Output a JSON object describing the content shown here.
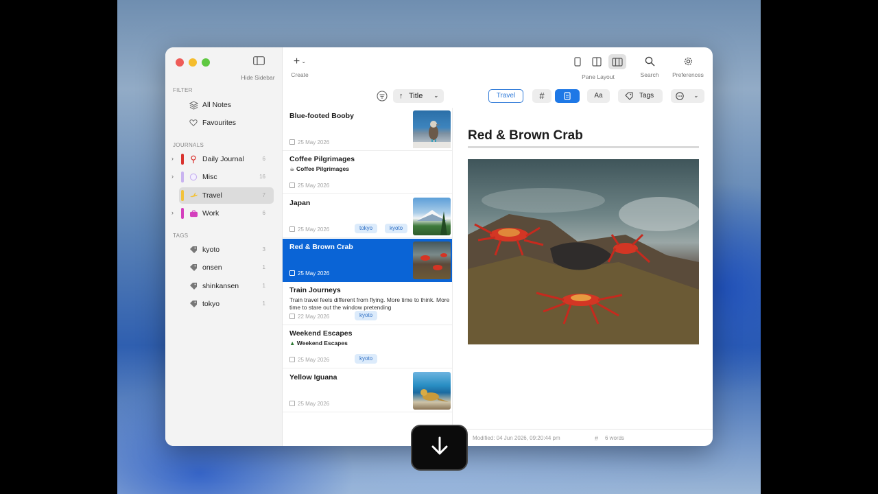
{
  "toolbar": {
    "hide_sidebar_label": "Hide Sidebar",
    "create_label": "Create",
    "pane_layout_label": "Pane Layout",
    "search_label": "Search",
    "preferences_label": "Preferences"
  },
  "sidebar": {
    "filter_heading": "FILTER",
    "filters": [
      {
        "label": "All Notes",
        "icon": "layers-icon"
      },
      {
        "label": "Favourites",
        "icon": "heart-icon"
      }
    ],
    "journals_heading": "JOURNALS",
    "journals": [
      {
        "label": "Daily Journal",
        "count": "6",
        "color": "#d9322e"
      },
      {
        "label": "Misc",
        "count": "16",
        "color": "#c9b3f0"
      },
      {
        "label": "Travel",
        "count": "7",
        "color": "#f2c23a"
      },
      {
        "label": "Work",
        "count": "6",
        "color": "#d43fbd"
      }
    ],
    "tags_heading": "TAGS",
    "tags": [
      {
        "label": "kyoto",
        "count": "3"
      },
      {
        "label": "onsen",
        "count": "1"
      },
      {
        "label": "shinkansen",
        "count": "1"
      },
      {
        "label": "tokyo",
        "count": "1"
      }
    ]
  },
  "list_toolbar": {
    "sort_label": "Title"
  },
  "notes": [
    {
      "title": "Blue-footed Booby",
      "date": "25 May 2026"
    },
    {
      "title": "Coffee Pilgrimages",
      "subtitle": "Coffee Pilgrimages",
      "date": "25 May 2026"
    },
    {
      "title": "Japan",
      "date": "25 May 2026",
      "tags": [
        "tokyo",
        "kyoto"
      ]
    },
    {
      "title": "Red & Brown Crab",
      "date": "25 May 2026"
    },
    {
      "title": "Train Journeys",
      "snippet": "Train travel feels different from flying. More time to think. More time to stare out the window pretending",
      "date": "22 May 2026",
      "tags": [
        "kyoto"
      ]
    },
    {
      "title": "Weekend Escapes",
      "subtitle": "Weekend Escapes",
      "date": "25 May 2026",
      "tags": [
        "kyoto"
      ]
    },
    {
      "title": "Yellow Iguana",
      "date": "25 May 2026"
    }
  ],
  "editor_toolbar": {
    "journal_label": "Travel",
    "hash_label": "#",
    "font_label": "Aa",
    "tags_label": "Tags"
  },
  "editor": {
    "title": "Red & Brown Crab",
    "modified": "Modified: 04 Jun 2026, 09:20:44 pm",
    "word_hash": "#",
    "word_count": "6 words"
  },
  "colors": {
    "accent": "#0a64d6",
    "tag_pill_bg": "#dcebfb"
  }
}
